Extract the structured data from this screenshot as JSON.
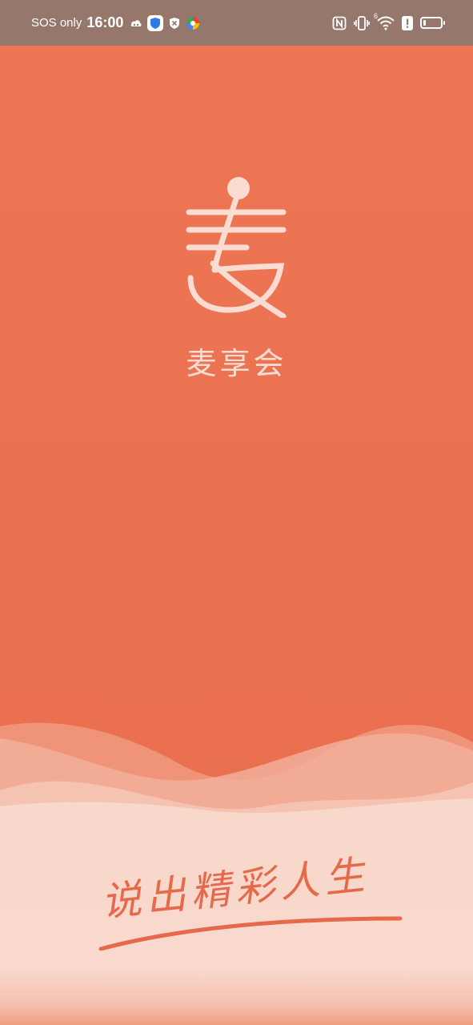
{
  "status_bar": {
    "carrier": "SOS only",
    "time": "16:00",
    "left_icons": [
      "cloud-game-icon",
      "shield-app-icon",
      "close-shield-icon",
      "browser-app-icon"
    ],
    "right_icons": [
      "nfc-icon",
      "vibrate-icon",
      "wifi-icon",
      "alert-icon",
      "battery-icon"
    ],
    "wifi_label": "6",
    "battery_level": 0.15
  },
  "splash": {
    "logo_glyph": "麦",
    "app_name": "麦享会",
    "slogan": "说出精彩人生"
  },
  "colors": {
    "status_bar_bg": "#95776C",
    "primary": "#EE7754",
    "logo": "#FBDCD2",
    "slogan": "#E5694A"
  }
}
